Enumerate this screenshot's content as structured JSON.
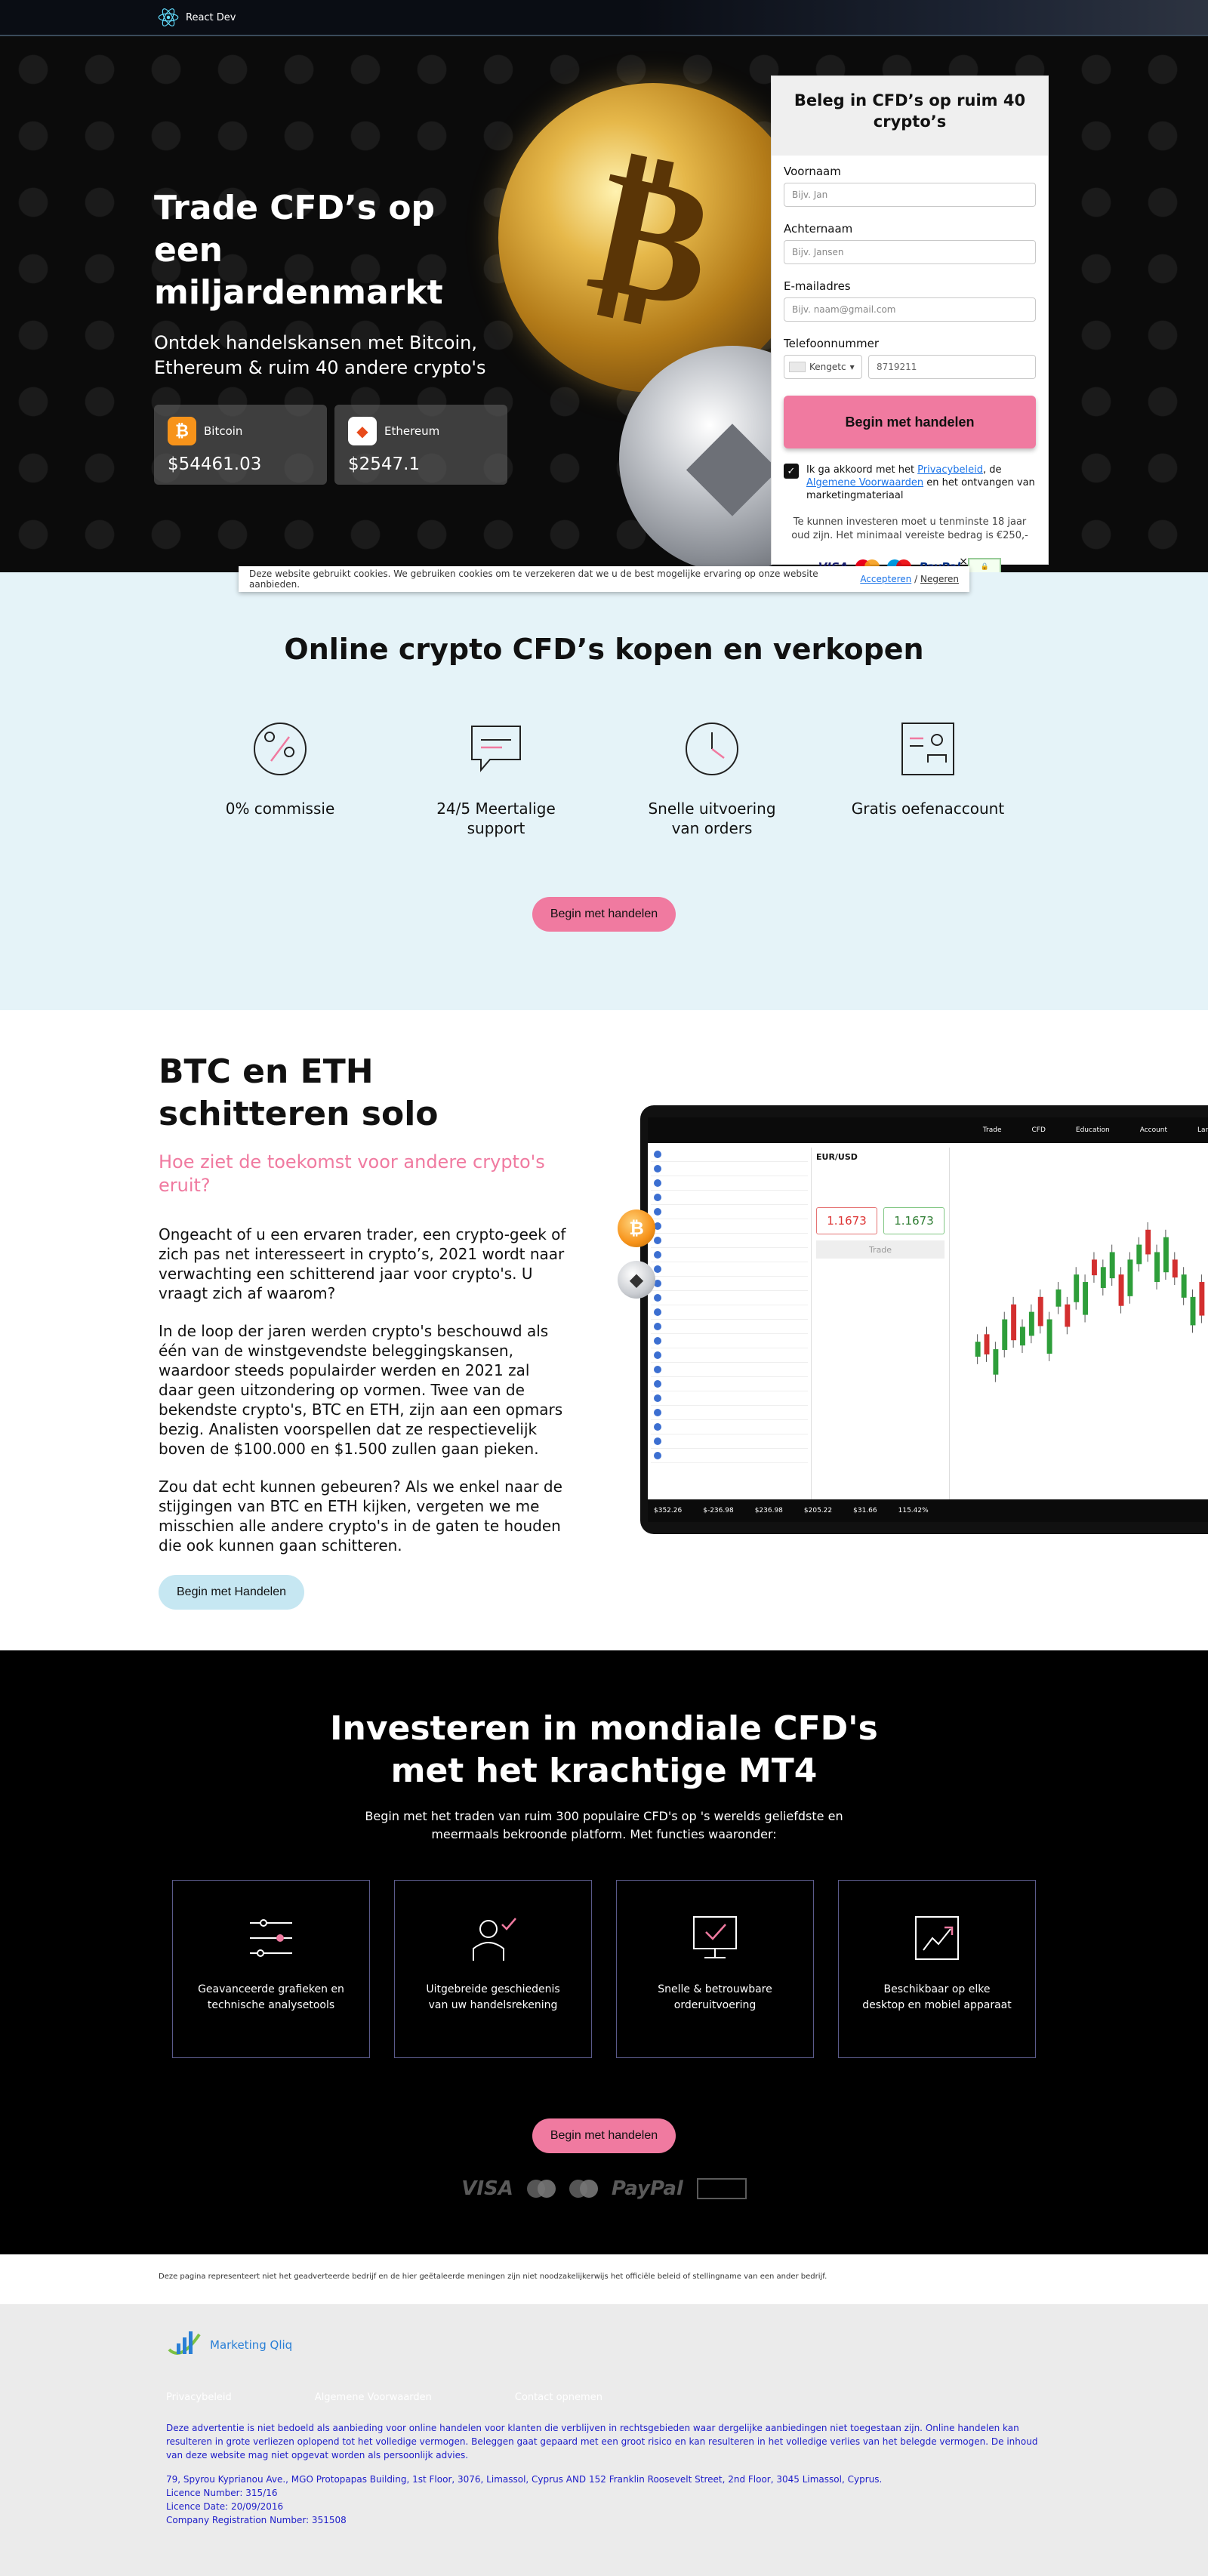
{
  "topbar": {
    "brand": "React Dev"
  },
  "hero": {
    "title": "Trade CFD’s op een miljardenmarkt",
    "subtitle": "Ontdek handelskansen met Bitcoin, Ethereum & ruim 40 andere crypto's",
    "tickers": [
      {
        "name": "Bitcoin",
        "price": "$54461.03",
        "icon": "bitcoin-icon"
      },
      {
        "name": "Ethereum",
        "price": "$2547.1",
        "icon": "ethereum-icon"
      }
    ]
  },
  "form": {
    "title": "Beleg in CFD’s op ruim 40 crypto’s",
    "fields": [
      {
        "label": "Voornaam",
        "placeholder": "Bijv. Jan"
      },
      {
        "label": "Achternaam",
        "placeholder": "Bijv. Jansen"
      },
      {
        "label": "E-mailadres",
        "placeholder": "Bijv. naam@gmail.com"
      }
    ],
    "phone_label": "Telefoonnummer",
    "phone_country": "Kengetc",
    "phone_value": "8719211",
    "submit": "Begin met handelen",
    "consent_pre": "Ik ga akkoord met het ",
    "consent_link1": "Privacybeleid",
    "consent_mid": ", de ",
    "consent_link2": "Algemene Voorwaarden",
    "consent_post": " en het ontvangen van marketingmateriaal",
    "age_note": "Te kunnen investeren moet u tenminste 18 jaar oud zijn. Het minimaal vereiste bedrag is €250,-",
    "payments": [
      "VISA",
      "PayPal"
    ]
  },
  "cookie": {
    "text": "Deze website gebruikt cookies. We gebruiken cookies om te verzekeren dat we u de best mogelijke ervaring op onze website aanbieden.",
    "accept": "Accepteren",
    "sep": "/",
    "ignore": "Negeren",
    "close": "×"
  },
  "features": {
    "title": "Online crypto CFD’s kopen en verkopen",
    "items": [
      {
        "label": "0% commissie",
        "icon": "percent-icon"
      },
      {
        "label": "24/5 Meertalige support",
        "icon": "chat-icon"
      },
      {
        "label": "Snelle uitvoering van orders",
        "icon": "clock-icon"
      },
      {
        "label": "Gratis oefenaccount",
        "icon": "account-icon"
      }
    ],
    "cta": "Begin met handelen"
  },
  "btceth": {
    "title": "BTC en ETH schitteren solo",
    "subtitle": "Hoe ziet de toekomst voor andere crypto's eruit?",
    "paragraphs": [
      "Ongeacht of u een ervaren trader, een crypto-geek of zich pas net interesseert in crypto’s, 2021 wordt naar verwachting een schitterend jaar voor crypto's. U vraagt zich af waarom?",
      "In de loop der jaren werden crypto's beschouwd als één van de winstgevendste beleggingskansen, waardoor steeds populairder werden en 2021 zal daar geen uitzondering op vormen. Twee van de bekendste crypto's, BTC en ETH, zijn aan een opmars bezig. Analisten voorspellen dat ze respectievelijk boven de $100.000 en $1.500 zullen gaan pieken.",
      "Zou dat echt kunnen gebeuren? Als we enkel naar de stijgingen van BTC en ETH kijken, vergeten we me misschien alle andere crypto's in de gaten te houden die ook kunnen gaan schitteren."
    ],
    "cta": "Begin met Handelen",
    "platform": {
      "nav": [
        "Trade",
        "CFD",
        "Education",
        "Account",
        "Lang"
      ],
      "pair": "EUR/USD",
      "sell": "1.1673",
      "buy": "1.1673",
      "trade": "Trade",
      "bottom": [
        "$352.26",
        "$-236.98",
        "$236.98",
        "$205.22",
        "$31.66",
        "115.42%"
      ]
    }
  },
  "mt4": {
    "title": "Investeren in mondiale CFD's met het krachtige MT4",
    "subtitle": "Begin met het traden van ruim 300 populaire CFD's op 's werelds geliefdste en meermaals bekroonde platform. Met functies waaronder:",
    "cards": [
      {
        "label": "Geavanceerde grafieken en technische analysetools",
        "icon": "sliders-icon"
      },
      {
        "label": "Uitgebreide geschiedenis van uw handelsrekening",
        "icon": "user-check-icon"
      },
      {
        "label": "Snelle & betrouwbare orderuitvoering",
        "icon": "monitor-check-icon"
      },
      {
        "label": "Beschikbaar op elke desktop en mobiel apparaat",
        "icon": "chart-up-icon"
      }
    ],
    "cta": "Begin met handelen",
    "payments": [
      "VISA",
      "PayPal"
    ]
  },
  "disclaimer": "Deze pagina representeert niet het geadverteerde bedrijf en de hier geëtaleerde meningen zijn niet noodzakelijkerwijs het officiële beleid of stellingname van een ander bedrijf.",
  "footer": {
    "brand": "Marketing Qliq",
    "links": [
      "Privacybeleid",
      "Algemene Voorwaarden",
      "Contact opnemen"
    ],
    "text1": "Deze advertentie is niet bedoeld als aanbieding voor online handelen voor klanten die verblijven in rechtsgebieden waar dergelijke aanbiedingen niet toegestaan zijn. Online handelen kan resulteren in grote verliezen oplopend tot het volledige vermogen. Beleggen gaat gepaard met een groot risico en kan resulteren in het volledige verlies van het belegde vermogen. De inhoud van deze website mag niet opgevat worden als persoonlijk advies.",
    "address": "79, Spyrou Kyprianou Ave., MGO Protopapas Building, 1st Floor, 3076, Limassol, Cyprus AND 152 Franklin Roosevelt Street, 2nd Floor, 3045 Limassol, Cyprus.",
    "licence": "Licence Number: 315/16",
    "licence_date": "Licence Date: 20/09/2016",
    "company": "Company Registration Number: 351508"
  }
}
